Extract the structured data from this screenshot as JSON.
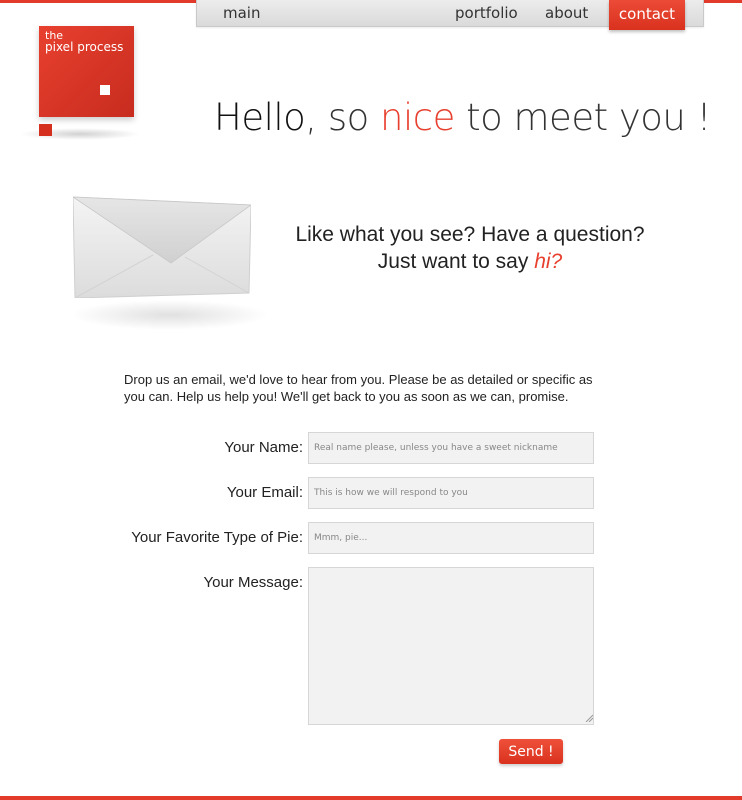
{
  "nav": {
    "main": "main",
    "portfolio": "portfolio",
    "about": "about",
    "contact": "contact"
  },
  "logo": {
    "line1": "the",
    "line2": "pixel process"
  },
  "headline": {
    "part1": "Hello",
    "part2": ", so ",
    "part3": "nice",
    "part4": " to meet you !"
  },
  "tagline": {
    "line1": "Like what you see? Have a question?",
    "line2": "Just want to say ",
    "hi": "hi?"
  },
  "intro": "Drop us an email, we'd love to hear from you. Please be as detailed or specific as you can. Help us help you! We'll get back to you as soon as we can, promise.",
  "form": {
    "name_label": "Your Name:",
    "name_placeholder": "Real name please, unless you have a sweet nickname",
    "email_label": "Your Email:",
    "email_placeholder": "This is how we will respond to you",
    "pie_label": "Your Favorite Type of Pie:",
    "pie_placeholder": "Mmm, pie...",
    "message_label": "Your Message:",
    "send_label": "Send !"
  },
  "colors": {
    "accent": "#e8402f",
    "field_bg": "#f2f2f2"
  }
}
